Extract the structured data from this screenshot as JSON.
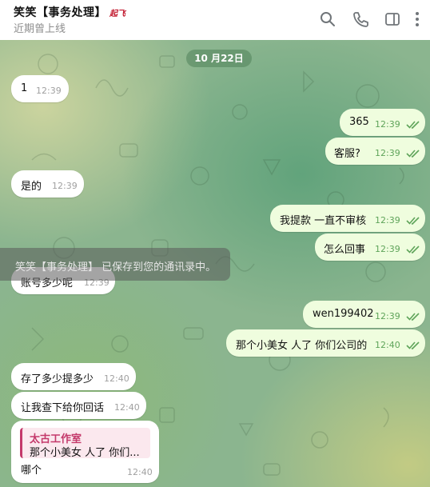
{
  "header": {
    "title": "笑笑【事务处理】",
    "badge": "起飞",
    "status": "近期曾上线",
    "icons": [
      "search-icon",
      "phone-icon",
      "sidebar-toggle-icon",
      "more-vertical-icon"
    ]
  },
  "chat": {
    "date_separator": "10 月22日",
    "messages": [
      {
        "dir": "in",
        "text": "1",
        "time": "12:39"
      },
      {
        "dir": "out",
        "text": "365",
        "time": "12:39",
        "read": true
      },
      {
        "dir": "out",
        "text": "客服?",
        "time": "12:39",
        "read": true
      },
      {
        "dir": "in",
        "text": "是的",
        "time": "12:39"
      },
      {
        "dir": "out",
        "text": "我提款 一直不审核",
        "time": "12:39",
        "read": true
      },
      {
        "dir": "out",
        "text": "怎么回事",
        "time": "12:39",
        "read": true
      },
      {
        "dir": "in",
        "text": "账号多少呢",
        "time": "12:39"
      },
      {
        "dir": "out",
        "text": "wen199402",
        "time": "12:39",
        "read": true
      },
      {
        "dir": "out",
        "text": "那个小美女 人了 你们公司的",
        "time": "12:40",
        "read": true
      },
      {
        "dir": "in",
        "text": "存了多少提多少",
        "time": "12:40"
      },
      {
        "dir": "in",
        "text": "让我查下给你回话",
        "time": "12:40"
      },
      {
        "dir": "in",
        "text": "哪个",
        "time": "12:40",
        "reply_to": {
          "name": "太古工作室",
          "text": "那个小美女 人了 你们..."
        }
      }
    ]
  },
  "toast": {
    "text": "笑笑【事务处理】 已保存到您的通讯录中。"
  },
  "colors": {
    "incoming_bubble": "#ffffff",
    "outgoing_bubble": "#effdde",
    "outgoing_time": "#5fa45a",
    "reply_accent": "#c4396b",
    "title_badge": "#c0152a"
  }
}
